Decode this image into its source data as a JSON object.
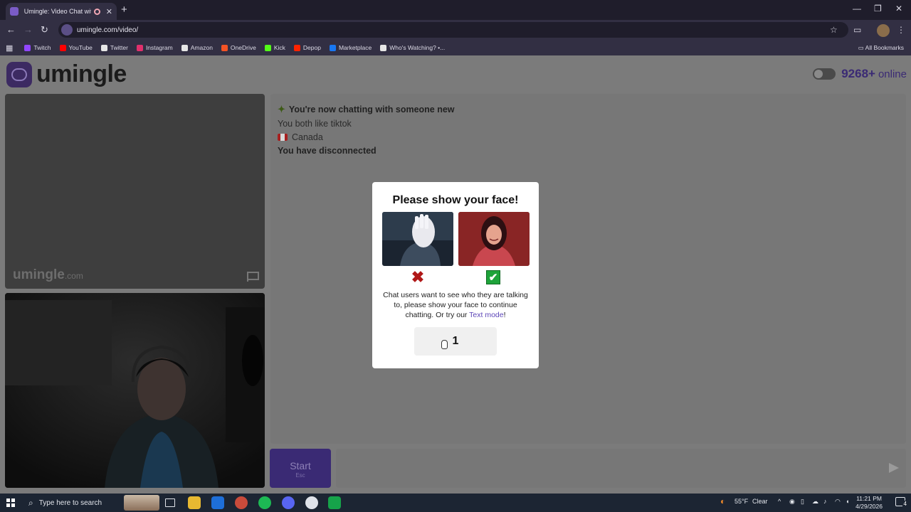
{
  "browser": {
    "tab_title": "Umingle: Video Chat with S",
    "tab_close": "✕",
    "new_tab": "+",
    "url": "umingle.com/video/",
    "window_controls": [
      "—",
      "❐",
      "✕"
    ],
    "bookmarks": [
      {
        "label": "Twitch",
        "color": "#9146ff"
      },
      {
        "label": "YouTube",
        "color": "#ff0000"
      },
      {
        "label": "Twitter",
        "color": "#e6e6e6"
      },
      {
        "label": "Instagram",
        "color": "#e1306c"
      },
      {
        "label": "Amazon",
        "color": "#e6e6e6"
      },
      {
        "label": "OneDrive",
        "color": "#f35325"
      },
      {
        "label": "Kick",
        "color": "#53fc18"
      },
      {
        "label": "Depop",
        "color": "#ff2300"
      },
      {
        "label": "Marketplace",
        "color": "#1877f2"
      },
      {
        "label": "Who's Watching? •...",
        "color": "#e6e6e6"
      }
    ],
    "all_bookmarks": "All Bookmarks"
  },
  "site": {
    "logo_text": "umingle",
    "online_count": "9268+",
    "online_label": "online",
    "watermark_name": "umingle",
    "watermark_tld": ".com"
  },
  "chat": {
    "messages": [
      {
        "text": "You're now chatting with someone new",
        "style": "bold",
        "icon": "star-icon"
      },
      {
        "text": "You both like tiktok",
        "style": "dim",
        "icon": ""
      },
      {
        "text": "Canada",
        "style": "dim",
        "icon": "canada-flag-icon"
      },
      {
        "text": "You have disconnected",
        "style": "bold",
        "icon": ""
      }
    ],
    "start_label": "Start",
    "start_key": "Esc"
  },
  "modal": {
    "title": "Please show your face!",
    "body_text": "Chat users want to see who they are talking to, please show your face to continue chatting. Or try our ",
    "link_text": "Text mode",
    "body_end": "!",
    "countdown": "1",
    "wrong_mark": "✖",
    "right_mark": "✔"
  },
  "taskbar": {
    "search_placeholder": "Type here to search",
    "weather_temp": "55°F",
    "weather_label": "Clear",
    "time": "11:21 PM",
    "date": "4/29/2026",
    "notification_count": "4"
  },
  "colors": {
    "accent": "#3a2a74",
    "link": "#5d46b8",
    "page_bg": "#7b7b7b"
  }
}
